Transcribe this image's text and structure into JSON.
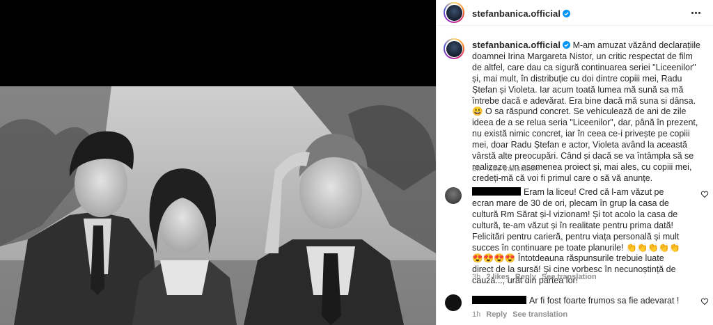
{
  "post": {
    "username": "stefanbanica.official",
    "verified": true
  },
  "caption": {
    "username": "stefanbanica.official",
    "text_a": "M-am amuzat văzând declarațiile doamnei Irina Margareta Nistor, un critic respectat de film de altfel, care dau ca sigură continuarea seriei \"Liceenilor\" și, mai mult, în distribuție cu doi dintre copiii mei, Radu Ștefan și Violeta. Iar acum toată lumea mă sună sa mă întrebe dacă e adevărat. Era bine dacă mă suna si dânsa. ",
    "emoji": "😃",
    "text_b": " O sa răspund concret. Se vehiculează de ani de zile ideea de a se relua seria \"Liceenilor\", dar, până în prezent, nu există nimic concret, iar în ceea ce-i privește pe copiii mei, doar Radu Ștefan e actor, Violeta având la această vârstă alte preocupări. Când și dacă se va întâmpla să se realizeze un asemenea proiect și, mai ales, cu copiii mei, credeți-mă că voi fi primul care o să vă anunțe.",
    "time": "3h",
    "see_translation": "See translation"
  },
  "comments": [
    {
      "text": "Eram la liceu! Cred că l-am văzut pe ecran mare de 30 de ori, plecam în grup la casa de cultură Rm Sărat și-l vizionam! Și tot acolo la casa de cultură, te-am văzut și în realitate pentru prima dată! Felicitări pentru carieră, pentru viața personală și mult succes în continuare pe toate planurile!",
      "emojis": [
        "👏",
        "👏",
        "👏",
        "👏",
        "👏",
        "😍",
        "😍",
        "😍",
        "😍"
      ],
      "text_after": "Întotdeauna răspunsurile trebuie luate direct de la sursă! Și cine vorbesc în necunoștință de cauză..., urât din partea lor!",
      "time": "3h",
      "likes": "2 likes",
      "reply": "Reply",
      "see_translation": "See translation"
    },
    {
      "text": "Ar fi fost foarte frumos sa fie adevarat !",
      "time": "1h",
      "reply": "Reply",
      "see_translation": "See translation"
    }
  ],
  "icons": {
    "more": "more-options-icon",
    "verified": "verified-badge-icon",
    "heart": "heart-outline-icon"
  },
  "colors": {
    "verified": "#0095f6",
    "secondary_text": "#8e8e8e",
    "redaction": "#000000"
  }
}
